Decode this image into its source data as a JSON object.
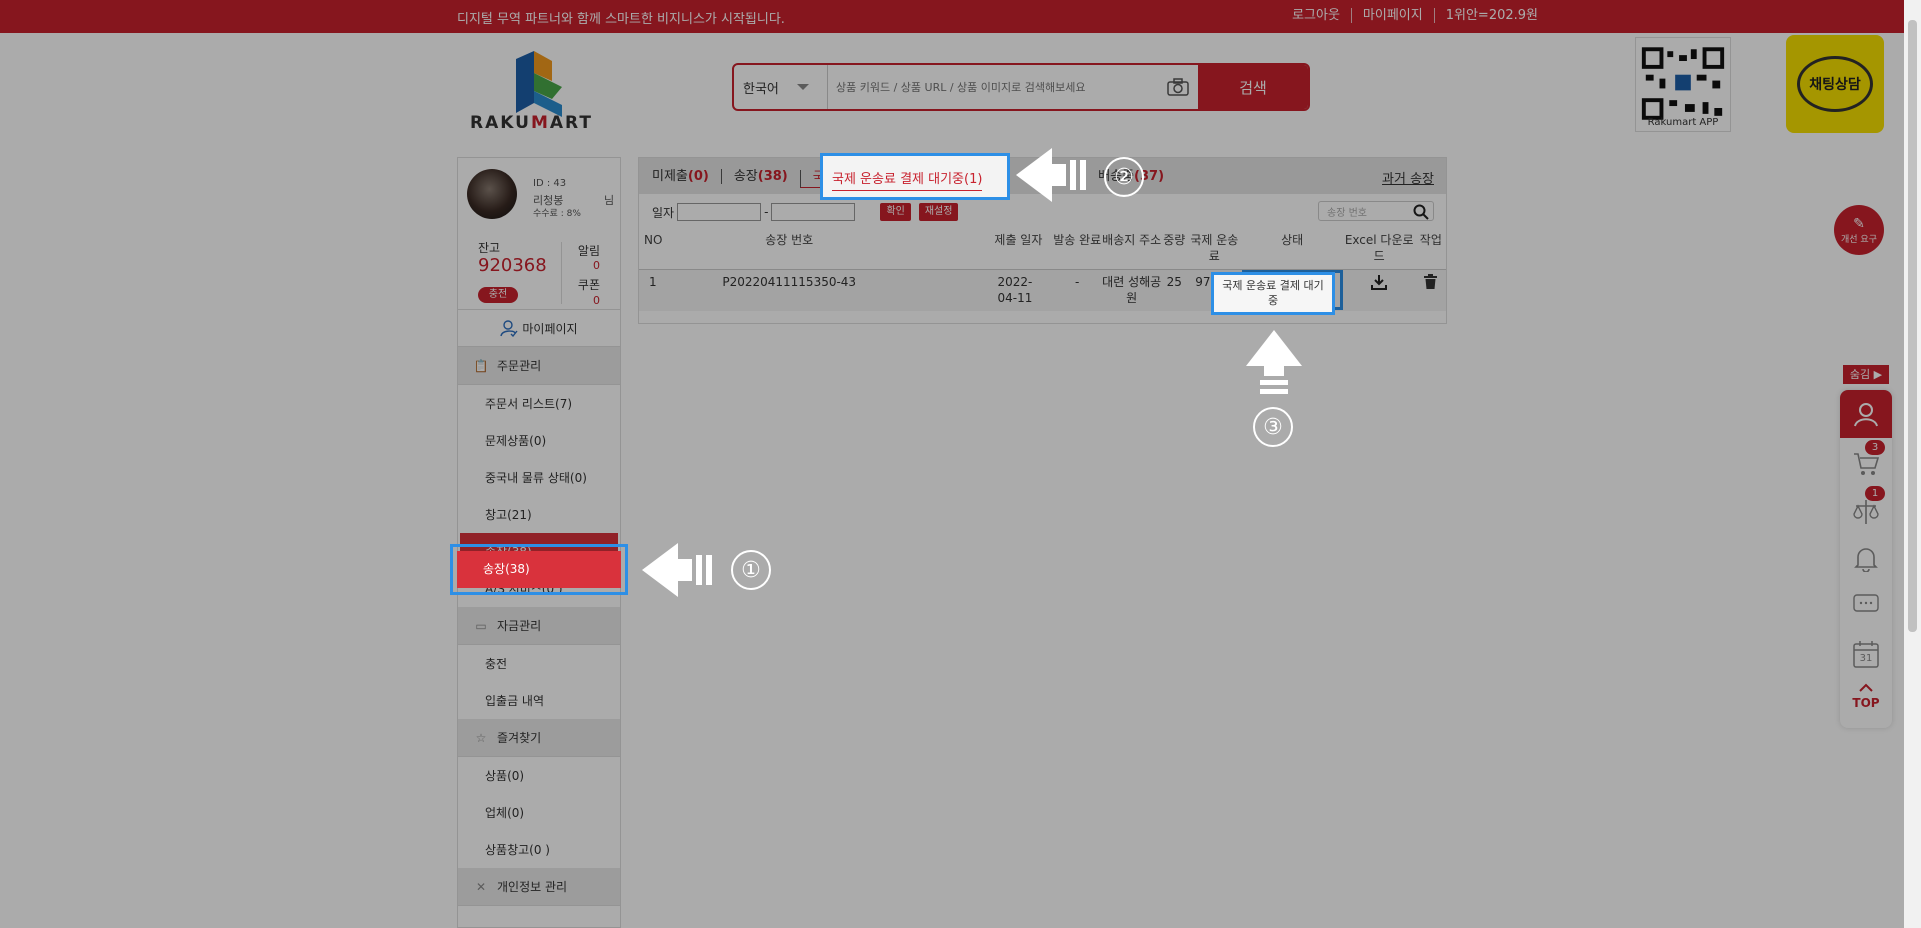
{
  "topbar": {
    "slogan": "디지털 무역 파트너와 함께 스마트한 비지니스가 시작됩니다.",
    "links": [
      "로그아웃",
      "마이페이지",
      "1위안=202.9원"
    ]
  },
  "logo": {
    "text_pre": "RAKU",
    "text_accent": "M",
    "text_post": "ART"
  },
  "search": {
    "language": "한국어",
    "placeholder": "상품 키워드 / 상품 URL / 상품 이미지로 검색해보세요",
    "button": "검색"
  },
  "qr_label": "Rakumart APP",
  "chat_label": "채팅상담",
  "improve_label": "개선 요구",
  "profile": {
    "id": "ID : 43",
    "name": "리청봉",
    "suffix": "님",
    "fee": "수수료 : 8%",
    "balance_label": "잔고",
    "balance": "920368",
    "charge": "충전",
    "alarm_label": "알림",
    "alarm_count": "0",
    "coupon_label": "쿠폰",
    "coupon_count": "0"
  },
  "sidebar": {
    "mypage": "마이페이지",
    "order_section": "주문관리",
    "order_items": [
      "주문서 리스트(7)",
      "문제상품(0)",
      "중국내 물류 상태(0)",
      "창고(21)",
      "송장(38)",
      "A/S 서비스(0 )"
    ],
    "fund_section": "자금관리",
    "fund_items": [
      "충전",
      "입출금 내역"
    ],
    "fav_section": "즐겨찾기",
    "fav_items": [
      "상품(0)",
      "업체(0)",
      "상품창고(0 )"
    ],
    "personal_section": "개인정보 관리"
  },
  "tabs": {
    "unsubmitted": "미제출",
    "unsubmitted_count": "(0)",
    "invoice": "송장",
    "invoice_count": "(38)",
    "awaiting_payment": "국제 운송료 결제 대기중(1)",
    "shipping_partial": "",
    "shipping_count": "(37)",
    "shipping_label": "배송중",
    "past": "과거 송장"
  },
  "filter": {
    "date_label": "일자",
    "dash": "-",
    "confirm": "확인",
    "reset": "재설정",
    "search_placeholder": "송장 번호"
  },
  "table": {
    "headers": [
      "NO",
      "송장 번호",
      "제출 일자",
      "발송 완료",
      "배송지 주소",
      "중량",
      "국제 운송료",
      "상태",
      "Excel 다운로드",
      "작업"
    ],
    "rows": [
      {
        "no": "1",
        "invoice": "P20220411115350-43",
        "date": "2022-04-11",
        "sent": "-",
        "address": "대련 성해공원",
        "weight": "25",
        "fee": "97798",
        "status": "국제 운송료 결제 대기중"
      }
    ]
  },
  "annotations": [
    "①",
    "②",
    "③"
  ],
  "rightbar": {
    "hide": "숨김 ▶",
    "cart_badge": "3",
    "fav_badge": "1",
    "calendar_day": "31",
    "top": "TOP"
  },
  "colors": {
    "brand": "#c8222e",
    "highlight": "#2d8fe6"
  }
}
